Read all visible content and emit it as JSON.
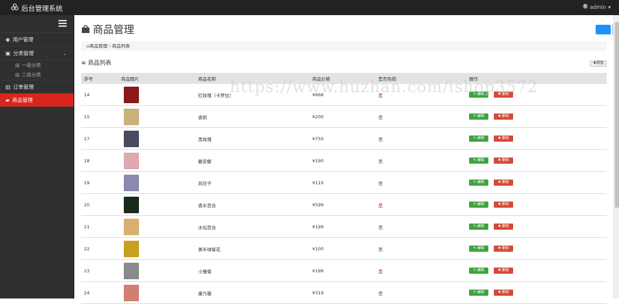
{
  "app": {
    "title": "后台管理系统",
    "user": "admin"
  },
  "sidebar": {
    "items": [
      {
        "label": "用户管理",
        "icon": "user-icon"
      },
      {
        "label": "分类管理",
        "icon": "tag-icon"
      },
      {
        "label": "订单管理",
        "icon": "document-icon"
      },
      {
        "label": "商品管理",
        "icon": "bag-icon"
      }
    ],
    "sub_items": [
      {
        "label": "一级分类"
      },
      {
        "label": "二级分类"
      }
    ]
  },
  "main": {
    "title": "商品管理",
    "breadcrumb": [
      "商品管理",
      "商品列表"
    ],
    "list_title": "≡ 商品列表",
    "add_label": "✚添加",
    "watermark": "https://www.huzhan.com/ishop3572"
  },
  "table": {
    "headers": [
      "序号",
      "商品图片",
      "商品名称",
      "商品价格",
      "是否热销",
      "操作"
    ],
    "edit_label": "✎ 编辑",
    "delete_label": "✖ 删除",
    "rows": [
      {
        "id": "14",
        "name": "红玫瑰（卡罗拉）",
        "price": "¥666",
        "hot": "是",
        "thumb": "#8a1a1a"
      },
      {
        "id": "15",
        "name": "香槟",
        "price": "¥200",
        "hot": "否",
        "thumb": "#c9b27a"
      },
      {
        "id": "17",
        "name": "黑玫瑰",
        "price": "¥750",
        "hot": "否",
        "thumb": "#4a4a60"
      },
      {
        "id": "18",
        "name": "戴安娜",
        "price": "¥190",
        "hot": "否",
        "thumb": "#e0a8b0"
      },
      {
        "id": "19",
        "name": "风信子",
        "price": "¥110",
        "hot": "否",
        "thumb": "#8a8ab0"
      },
      {
        "id": "20",
        "name": "香水百合",
        "price": "¥599",
        "hot": "是",
        "thumb": "#1a2a1a"
      },
      {
        "id": "21",
        "name": "水仙百合",
        "price": "¥199",
        "hot": "否",
        "thumb": "#d9b070"
      },
      {
        "id": "22",
        "name": "黄半球菊花",
        "price": "¥100",
        "hot": "否",
        "thumb": "#c8a020"
      },
      {
        "id": "23",
        "name": "小雏菊",
        "price": "¥199",
        "hot": "是",
        "thumb": "#8a8a8a"
      },
      {
        "id": "24",
        "name": "康乃馨",
        "price": "¥319",
        "hot": "否",
        "thumb": "#d08070"
      }
    ]
  }
}
